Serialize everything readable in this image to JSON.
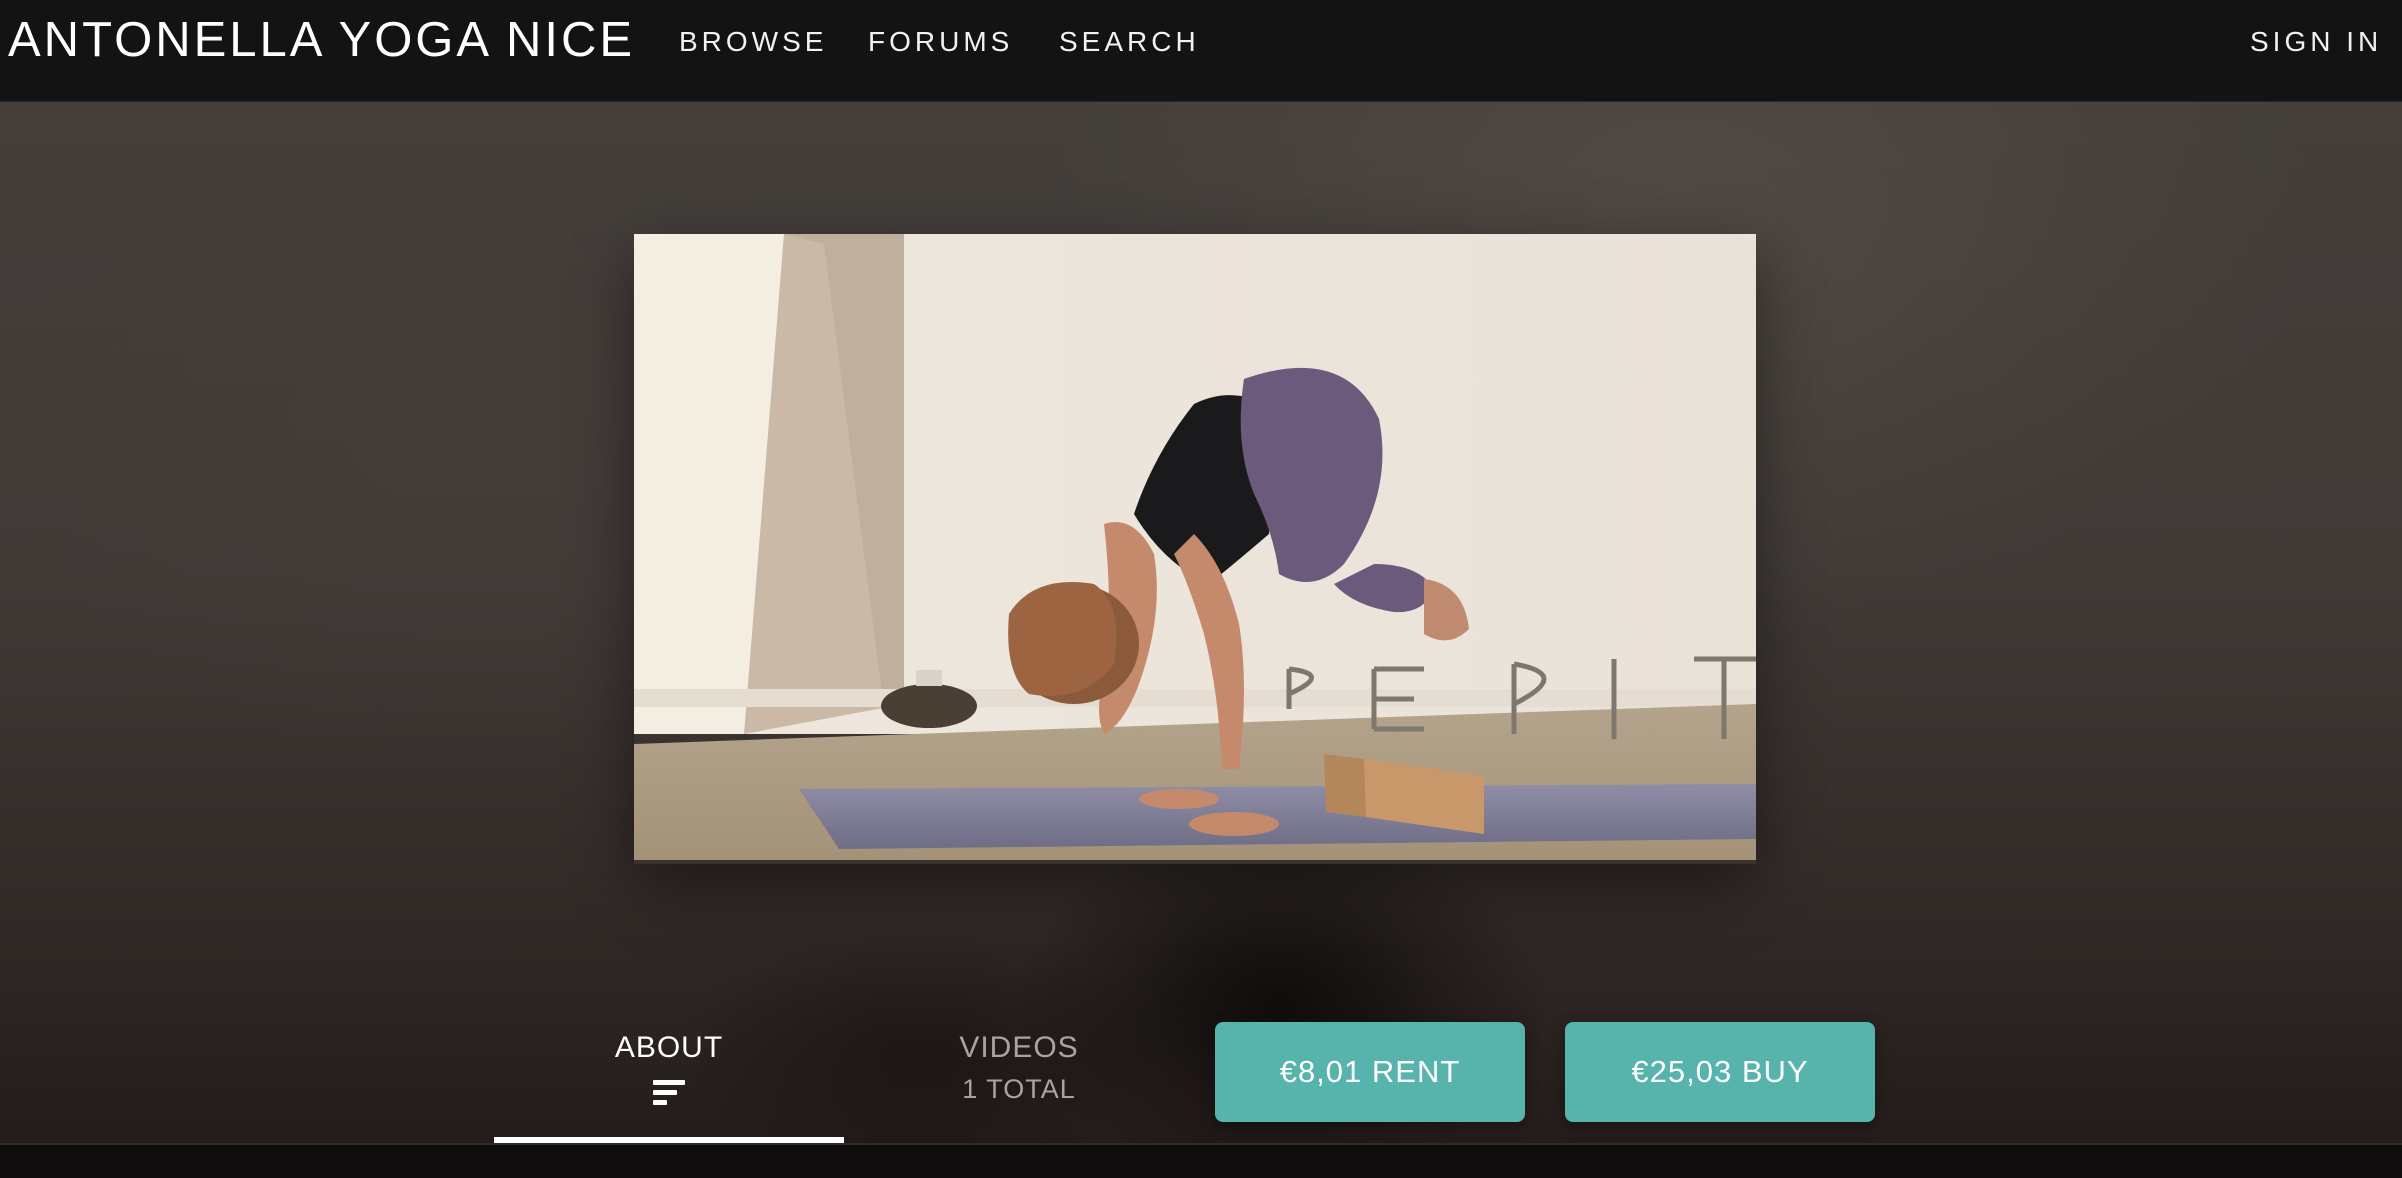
{
  "site": {
    "brand": "ANTONELLA YOGA NICE"
  },
  "nav": {
    "browse": "BROWSE",
    "forums": "FORUMS",
    "search": "SEARCH",
    "sign_in": "SIGN IN"
  },
  "hero": {
    "thumbnail_icon": "yoga-crow-pose-image"
  },
  "tabs": [
    {
      "label": "ABOUT",
      "icon": "text-lines-icon",
      "active": true
    },
    {
      "label": "VIDEOS",
      "sub": "1 TOTAL",
      "active": false
    }
  ],
  "actions": {
    "rent": "€8,01 RENT",
    "buy": "€25,03 BUY"
  },
  "colors": {
    "topbar": "#131313",
    "accent": "#57b4ad",
    "tab_active": "#ffffff",
    "tab_inactive": "#a8a4a1"
  }
}
